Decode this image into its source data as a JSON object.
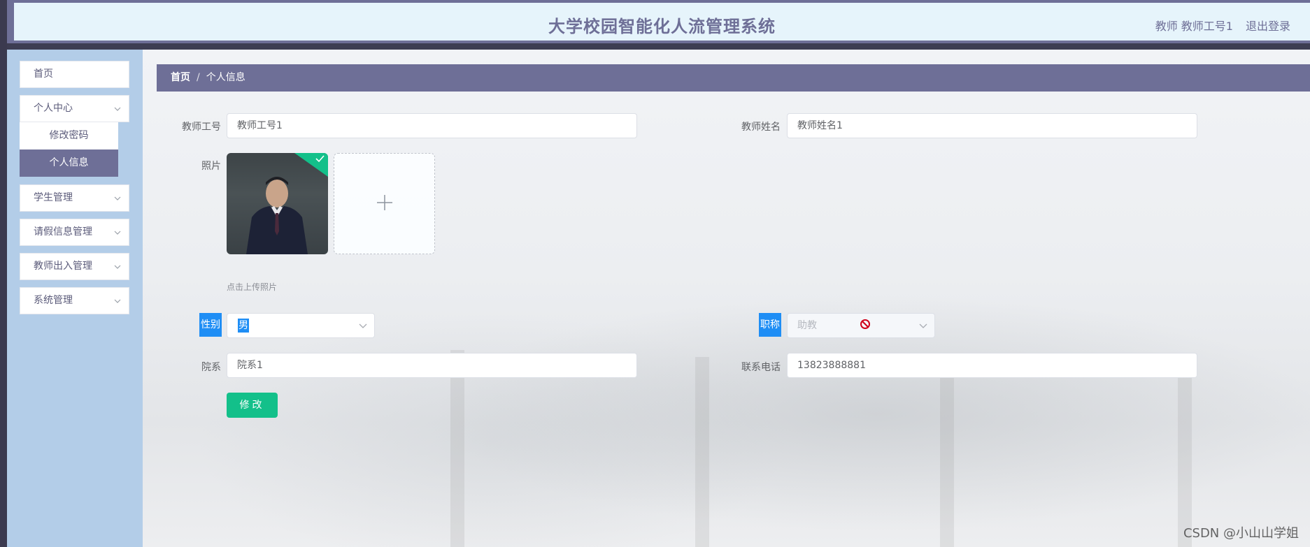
{
  "header": {
    "title": "大学校园智能化人流管理系统",
    "user": "教师 教师工号1",
    "logout": "退出登录"
  },
  "sidebar": {
    "items": [
      {
        "label": "首页"
      },
      {
        "label": "个人中心",
        "expanded": true
      },
      {
        "label": "学生管理"
      },
      {
        "label": "请假信息管理"
      },
      {
        "label": "教师出入管理"
      },
      {
        "label": "系统管理"
      }
    ],
    "submenu": [
      {
        "label": "修改密码"
      },
      {
        "label": "个人信息",
        "active": true
      }
    ]
  },
  "breadcrumb": {
    "home": "首页",
    "separator": "/",
    "current": "个人信息"
  },
  "form": {
    "teacher_id": {
      "label": "教师工号",
      "value": "教师工号1"
    },
    "teacher_name": {
      "label": "教师姓名",
      "value": "教师姓名1"
    },
    "photo": {
      "label": "照片",
      "tip": "点击上传照片"
    },
    "gender": {
      "label": "性别",
      "value": "男"
    },
    "title": {
      "label": "职称",
      "value": "助教"
    },
    "department": {
      "label": "院系",
      "value": "院系1"
    },
    "phone": {
      "label": "联系电话",
      "value": "13823888881"
    },
    "submit": "修改"
  },
  "watermark": "CSDN @小山山学姐",
  "colors": {
    "primary": "#6e6f97",
    "sidebar_bg": "#b3cde8",
    "success": "#13c08a",
    "highlight": "#1f8ef5"
  }
}
